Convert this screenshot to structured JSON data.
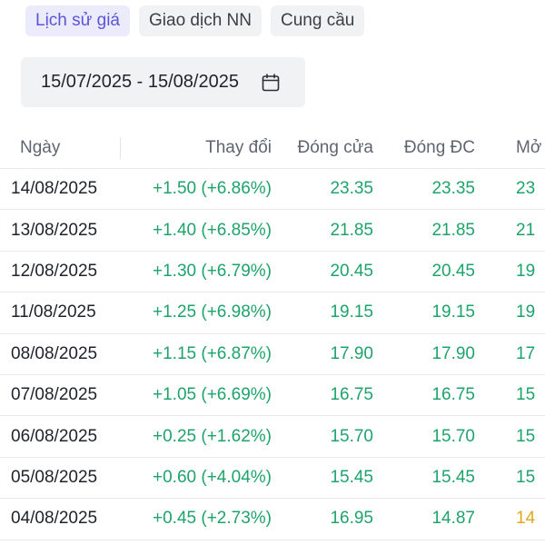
{
  "tabs": [
    {
      "label": "Lịch sử giá",
      "active": true
    },
    {
      "label": "Giao dịch NN",
      "active": false
    },
    {
      "label": "Cung cầu",
      "active": false
    }
  ],
  "date_filter": {
    "value": "15/07/2025 - 15/08/2025",
    "icon": "calendar-icon"
  },
  "table": {
    "headers": {
      "date": "Ngày",
      "change": "Thay đổi",
      "close": "Đóng cửa",
      "adj_close": "Đóng ĐC",
      "open": "Mở"
    },
    "rows": [
      {
        "date": "14/08/2025",
        "change": "+1.50 (+6.86%)",
        "close": "23.35",
        "adj_close": "23.35",
        "open": "23"
      },
      {
        "date": "13/08/2025",
        "change": "+1.40 (+6.85%)",
        "close": "21.85",
        "adj_close": "21.85",
        "open": "21"
      },
      {
        "date": "12/08/2025",
        "change": "+1.30 (+6.79%)",
        "close": "20.45",
        "adj_close": "20.45",
        "open": "19"
      },
      {
        "date": "11/08/2025",
        "change": "+1.25 (+6.98%)",
        "close": "19.15",
        "adj_close": "19.15",
        "open": "19"
      },
      {
        "date": "08/08/2025",
        "change": "+1.15 (+6.87%)",
        "close": "17.90",
        "adj_close": "17.90",
        "open": "17"
      },
      {
        "date": "07/08/2025",
        "change": "+1.05 (+6.69%)",
        "close": "16.75",
        "adj_close": "16.75",
        "open": "15"
      },
      {
        "date": "06/08/2025",
        "change": "+0.25 (+1.62%)",
        "close": "15.70",
        "adj_close": "15.70",
        "open": "15"
      },
      {
        "date": "05/08/2025",
        "change": "+0.60 (+4.04%)",
        "close": "15.45",
        "adj_close": "15.45",
        "open": "15"
      },
      {
        "date": "04/08/2025",
        "change": "+0.45 (+2.73%)",
        "close": "16.95",
        "adj_close": "14.87",
        "open": "14",
        "open_color": "ref"
      }
    ]
  },
  "colors": {
    "up": "#1ea36b",
    "reference": "#e0a91b",
    "accent": "#5b55d6"
  }
}
